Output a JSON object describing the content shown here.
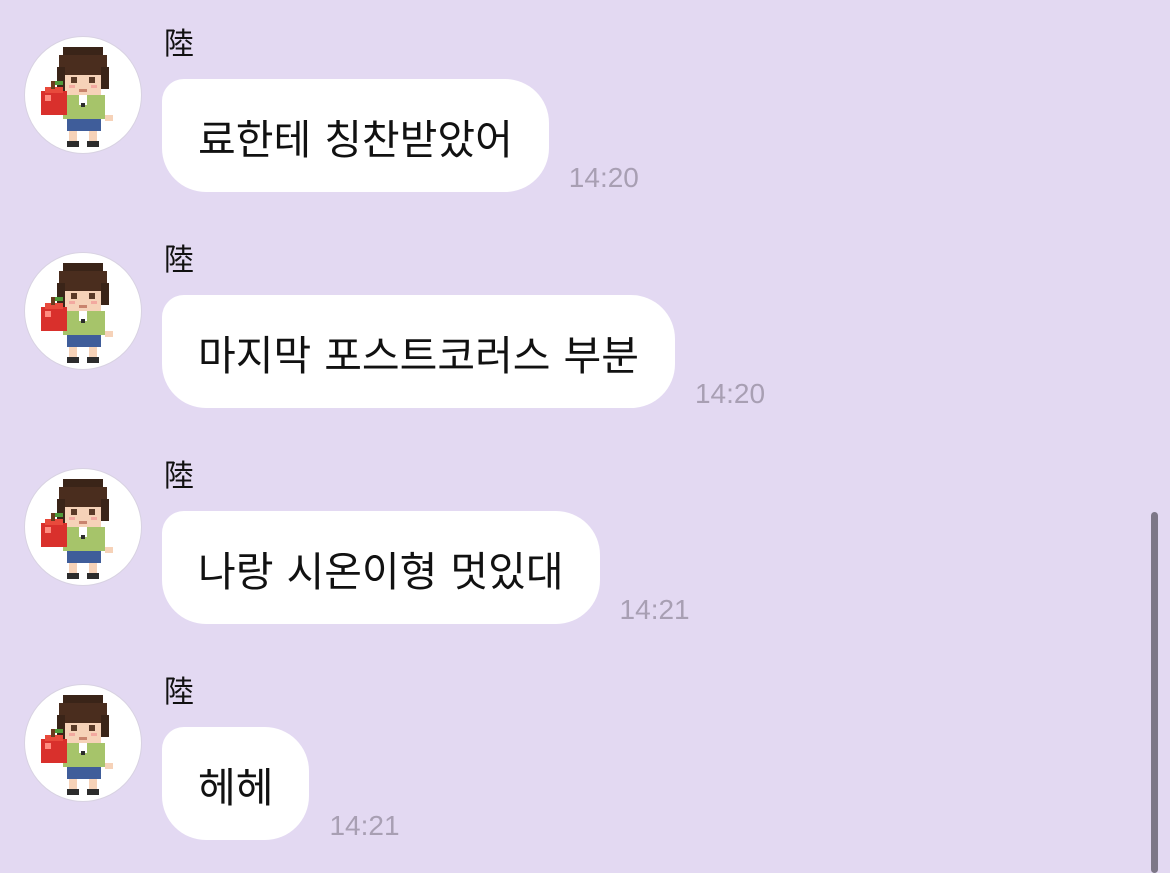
{
  "colors": {
    "background": "#e3d9f2",
    "bubble": "#ffffff",
    "timestamp": "#a89fb3"
  },
  "messages": [
    {
      "sender": "陸",
      "text": "료한테 칭찬받았어",
      "time": "14:20",
      "avatar_icon": "pixel-boy-with-apple-icon"
    },
    {
      "sender": "陸",
      "text": "마지막 포스트코러스 부분",
      "time": "14:20",
      "avatar_icon": "pixel-boy-with-apple-icon"
    },
    {
      "sender": "陸",
      "text": "나랑 시온이형 멋있대",
      "time": "14:21",
      "avatar_icon": "pixel-boy-with-apple-icon"
    },
    {
      "sender": "陸",
      "text": "헤헤",
      "time": "14:21",
      "avatar_icon": "pixel-boy-with-apple-icon"
    }
  ]
}
